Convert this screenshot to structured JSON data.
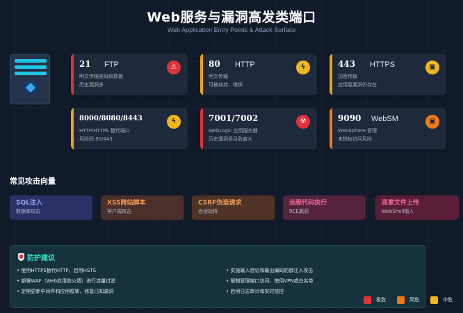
{
  "header": {
    "title": "Web服务与漏洞高发类端口",
    "subtitle": "Web Application Entry Points & Attack Surface"
  },
  "cards": [
    {
      "port": "21",
      "protocol": "FTP",
      "line1": "明文传输密码和数据",
      "line2": "历史漏洞多",
      "accent": "#e0323a",
      "badge_color": "#e0323a",
      "icon": "warning-icon"
    },
    {
      "port": "80",
      "protocol": "HTTP",
      "line1": "明文传输",
      "line2": "可被劫持、嗅探",
      "accent": "#e6a817",
      "badge_color": "#f0b71c",
      "icon": "lightning-icon"
    },
    {
      "port": "443",
      "protocol": "HTTPS",
      "line1": "加密传输",
      "line2": "应用层漏洞仍存在",
      "accent": "#e6a817",
      "badge_color": "#f0b71c",
      "icon": "lock-icon"
    },
    {
      "port": "8000/8080/8443",
      "protocol": "",
      "line1": "HTTP/HTTPS 替代端口",
      "line2": "风险同 80/443",
      "accent": "#e6a817",
      "badge_color": "#f0b71c",
      "icon": "lightning-icon"
    },
    {
      "port": "7001/7002",
      "protocol": "",
      "line1": "WebLogic 应用服务器",
      "line2": "历史漏洞多且危害大",
      "accent": "#e0323a",
      "badge_color": "#e0323a",
      "icon": "radiation-icon"
    },
    {
      "port": "9090",
      "protocol": "WebSM",
      "line1": "WebSphere 管理",
      "line2": "未授权访问风险",
      "accent": "#f07a1a",
      "badge_color": "#f07a1a",
      "icon": "lock-icon"
    }
  ],
  "vectors": {
    "title": "常见攻击向量",
    "items": [
      {
        "name": "SQL注入",
        "sub": "数据库攻击",
        "bg": "#2b3066",
        "color": "#9aa6ff"
      },
      {
        "name": "XSS跨站脚本",
        "sub": "客户端攻击",
        "bg": "#4a2f2a",
        "color": "#f79a55"
      },
      {
        "name": "CSRF伪造请求",
        "sub": "会话劫持",
        "bg": "#4f3324",
        "color": "#f0a060"
      },
      {
        "name": "远程代码执行",
        "sub": "RCE漏洞",
        "bg": "#54233c",
        "color": "#f26a9a"
      },
      {
        "name": "恶意文件上传",
        "sub": "WebShell植入",
        "bg": "#5a1f37",
        "color": "#f26a9a"
      }
    ]
  },
  "protection": {
    "title": "防护建议",
    "left": [
      "• 使用HTTPS替代HTTP，启用HSTS",
      "• 部署WAF（Web应用防火墙）进行流量过滤",
      "• 定期更新中间件和应用框架，修复已知漏洞"
    ],
    "right": [
      "• 实施输入验证和输出编码防御注入攻击",
      "• 限制管理端口访问，使用VPN或白名单",
      "• 启用日志审计和实时监控"
    ]
  },
  "legend": [
    {
      "label": "极危",
      "color": "#e0323a"
    },
    {
      "label": "高危",
      "color": "#f07a1a"
    },
    {
      "label": "中危",
      "color": "#f0b71c"
    }
  ]
}
